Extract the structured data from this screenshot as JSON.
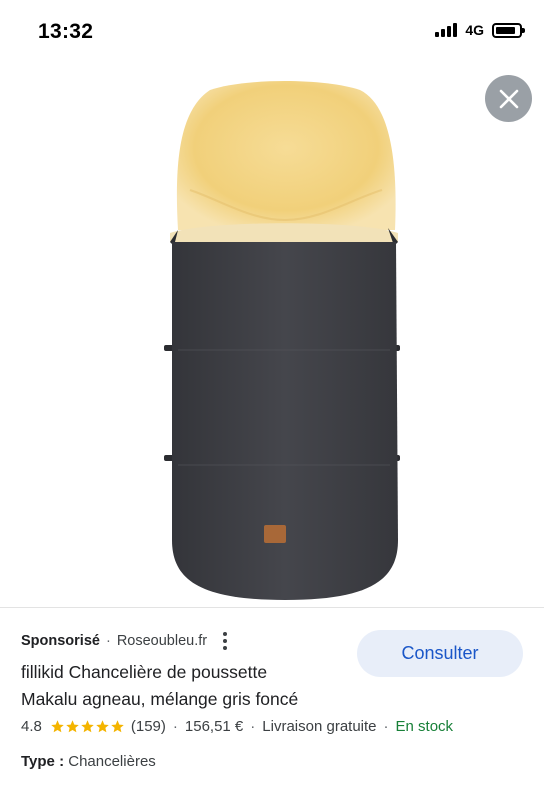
{
  "status_bar": {
    "time": "13:32",
    "network": "4G"
  },
  "close_icon": "close-icon",
  "product": {
    "image_description_icon": "footmuff-image",
    "colors": {
      "fleece": "#f3d58a",
      "body": "#3f4045"
    }
  },
  "ad": {
    "sponsored_label": "Sponsorisé",
    "separator": "·",
    "domain": "Roseoubleu.fr",
    "title_line1": "fillikid Chancelière de poussette",
    "title_line2": "Makalu agneau, mélange gris foncé",
    "consult_label": "Consulter",
    "rating": "4.8",
    "review_count": "(159)",
    "price": "156,51 €",
    "shipping": "Livraison gratuite",
    "stock": "En stock",
    "type_label": "Type :",
    "type_value": "Chancelières"
  },
  "colors": {
    "accent": "#1a56c8",
    "button_bg": "#e8eef9",
    "stock_green": "#188038",
    "star": "#f4b400"
  }
}
